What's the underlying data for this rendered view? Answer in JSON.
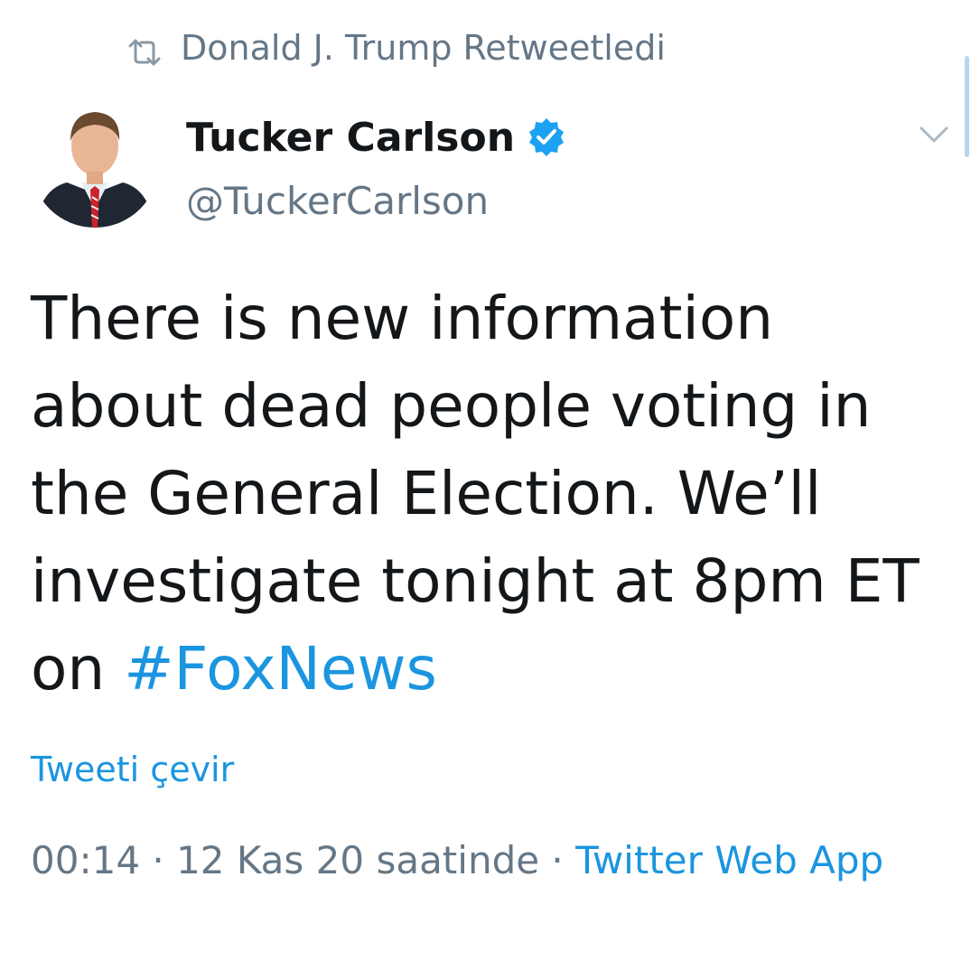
{
  "retweet": {
    "icon": "retweet-icon",
    "text": "Donald J. Trump Retweetledi"
  },
  "author": {
    "name": "Tucker Carlson",
    "handle": "@TuckerCarlson",
    "verified_icon": "verified-badge-icon",
    "avatar": "avatar-photo"
  },
  "tweet": {
    "text": "There is new information about dead people voting in the General Election. We’ll investigate tonight at 8pm ET on ",
    "hashtag": "#FoxNews"
  },
  "translate": {
    "label": "Tweeti çevir"
  },
  "meta": {
    "timestamp": "00:14 · 12 Kas 20 saatinde",
    "separator": " · ",
    "app": "Twitter Web App"
  },
  "menu": {
    "icon": "chevron-down-icon"
  },
  "colors": {
    "link": "#1b95e0",
    "secondary_text": "#657786",
    "primary_text": "#14171a",
    "verified": "#1da1f2"
  }
}
